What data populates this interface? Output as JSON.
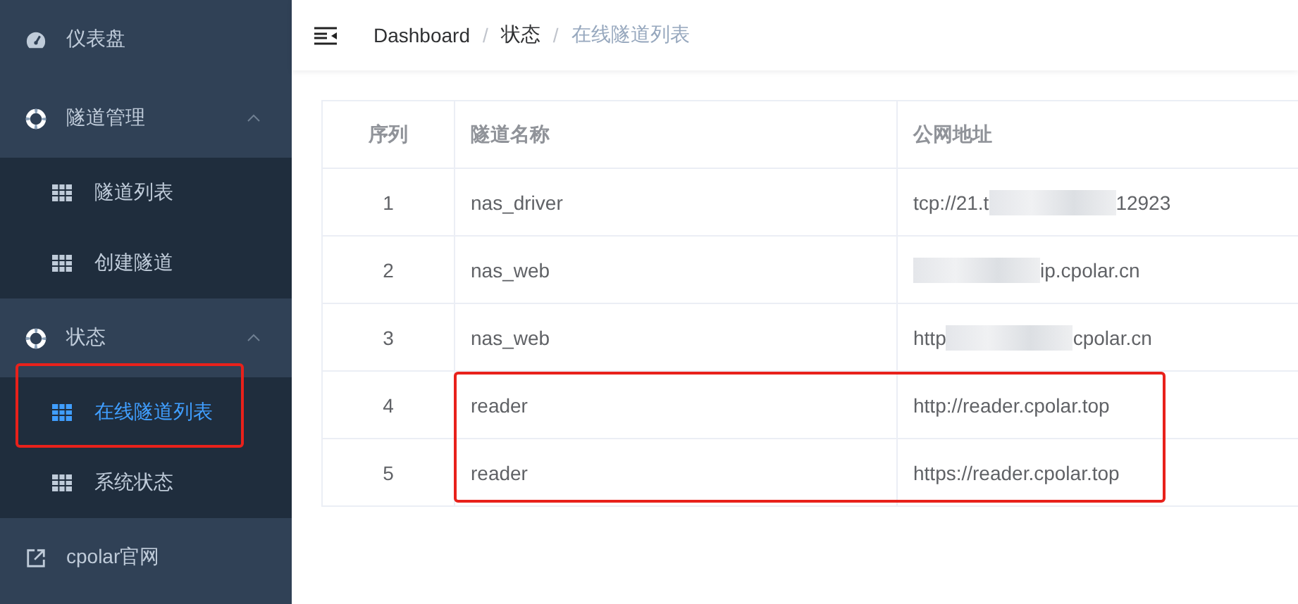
{
  "sidebar": {
    "items": [
      {
        "label": "仪表盘",
        "kind": "gauge",
        "selected": false
      },
      {
        "label": "隧道管理",
        "kind": "lifebuoy",
        "expanded": true,
        "selected": false,
        "children": [
          {
            "label": "隧道列表",
            "selected": false,
            "highlighted": false
          },
          {
            "label": "创建隧道",
            "selected": false,
            "highlighted": false
          }
        ]
      },
      {
        "label": "状态",
        "kind": "lifebuoy",
        "expanded": true,
        "selected": false,
        "children": [
          {
            "label": "在线隧道列表",
            "selected": true,
            "highlighted": true
          },
          {
            "label": "系统状态",
            "selected": false,
            "highlighted": false
          }
        ]
      },
      {
        "label": "cpolar官网",
        "kind": "external",
        "selected": false
      }
    ]
  },
  "breadcrumb": [
    {
      "label": "Dashboard"
    },
    {
      "separator": "/",
      "label": "状态"
    },
    {
      "separator": "/",
      "label": "在线隧道列表"
    }
  ],
  "table": {
    "columns": [
      "序列",
      "隧道名称",
      "公网地址"
    ],
    "rows": [
      {
        "index": "1",
        "name": "nas_driver",
        "address": {
          "start": "tcp://21.t",
          "end": "12923",
          "redacted": true
        },
        "highlighted": false
      },
      {
        "index": "2",
        "name": "nas_web",
        "address": {
          "end": "ip.cpolar.cn",
          "redacted": true
        },
        "highlighted": false
      },
      {
        "index": "3",
        "name": "nas_web",
        "address": {
          "start": "http",
          "end": "cpolar.cn",
          "redacted": true
        },
        "highlighted": false
      },
      {
        "index": "4",
        "name": "reader",
        "address": {
          "start": "http://reader.cpolar.top",
          "redacted": false
        },
        "highlighted": true
      },
      {
        "index": "5",
        "name": "reader",
        "address": {
          "start": "https://reader.cpolar.top",
          "redacted": false
        },
        "highlighted": true
      }
    ]
  }
}
